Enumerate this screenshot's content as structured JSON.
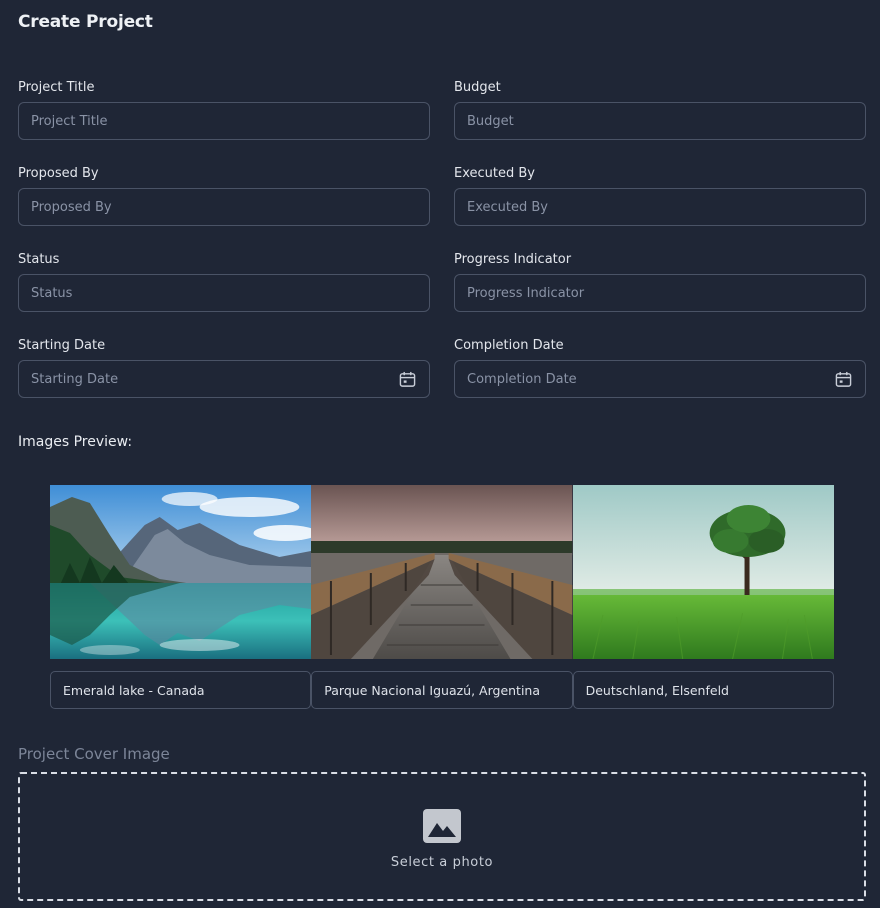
{
  "page": {
    "title": "Create Project"
  },
  "form": {
    "project_title": {
      "label": "Project Title",
      "placeholder": "Project Title",
      "value": ""
    },
    "budget": {
      "label": "Budget",
      "placeholder": "Budget",
      "value": ""
    },
    "proposed_by": {
      "label": "Proposed By",
      "placeholder": "Proposed By",
      "value": ""
    },
    "executed_by": {
      "label": "Executed By",
      "placeholder": "Executed By",
      "value": ""
    },
    "status": {
      "label": "Status",
      "placeholder": "Status",
      "value": ""
    },
    "progress": {
      "label": "Progress Indicator",
      "placeholder": "Progress Indicator",
      "value": ""
    },
    "start_date": {
      "label": "Starting Date",
      "placeholder": "Starting Date",
      "value": "",
      "icon": "calendar-icon"
    },
    "end_date": {
      "label": "Completion Date",
      "placeholder": "Completion Date",
      "value": "",
      "icon": "calendar-icon"
    }
  },
  "preview": {
    "title": "Images Preview:",
    "images": [
      {
        "caption": "Emerald lake - Canada",
        "scene": "mountain-lake"
      },
      {
        "caption": "Parque Nacional Iguazú, Argentina",
        "scene": "boardwalk"
      },
      {
        "caption": "Deutschland, Elsenfeld",
        "scene": "tree-field"
      }
    ]
  },
  "cover": {
    "label": "Project Cover Image",
    "select_text": "Select a photo",
    "icon": "photo-icon"
  },
  "colors": {
    "background": "#1f2636",
    "border": "#4a5366",
    "placeholder": "#8a93a6",
    "muted_label": "#7c8598"
  }
}
